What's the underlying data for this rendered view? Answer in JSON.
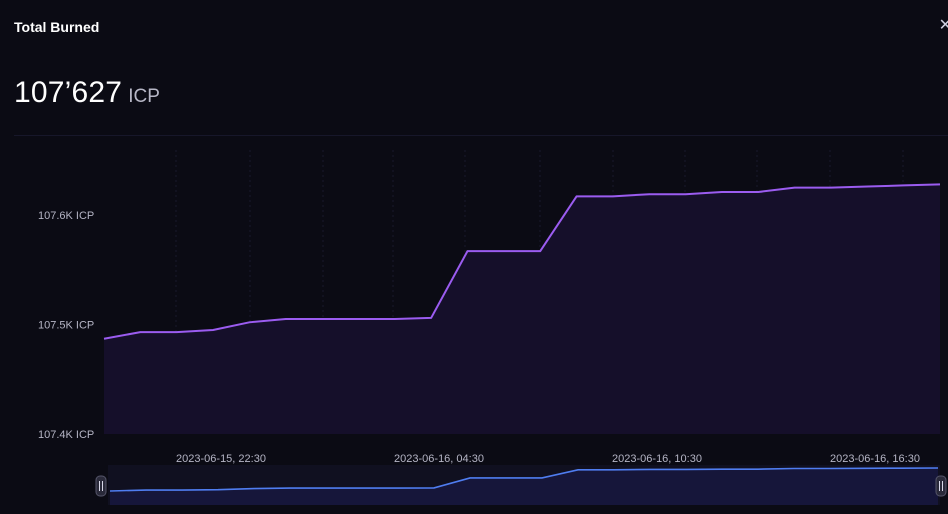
{
  "header": {
    "title": "Total Burned",
    "value": "107’627",
    "unit": "ICP",
    "close_icon": "close-icon"
  },
  "colors": {
    "background": "#0b0b14",
    "line": "#9b5cf0",
    "area": "#150f2a",
    "navigator_line": "#4f7df0",
    "navigator_area": "#16163a"
  },
  "chart_data": {
    "type": "area",
    "title": "",
    "xlabel": "",
    "ylabel": "",
    "ylim": [
      107400,
      107600
    ],
    "yticks": [
      107400,
      107500,
      107600
    ],
    "ytick_labels": [
      "107.4K ICP",
      "107.5K ICP",
      "107.6K ICP"
    ],
    "xtick_labels": [
      "2023-06-15, 22:30",
      "2023-06-16, 04:30",
      "2023-06-16, 10:30",
      "2023-06-16, 16:30"
    ],
    "grid": true,
    "series": [
      {
        "x": [
          "2023-06-15, 18:30",
          "2023-06-15, 19:30",
          "2023-06-15, 20:30",
          "2023-06-15, 21:30",
          "2023-06-15, 22:30",
          "2023-06-15, 23:30",
          "2023-06-16, 00:30",
          "2023-06-16, 01:30",
          "2023-06-16, 02:30",
          "2023-06-16, 03:30",
          "2023-06-16, 04:30",
          "2023-06-16, 05:30",
          "2023-06-16, 06:30",
          "2023-06-16, 07:30",
          "2023-06-16, 08:30",
          "2023-06-16, 09:30",
          "2023-06-16, 10:30",
          "2023-06-16, 11:30",
          "2023-06-16, 12:30",
          "2023-06-16, 13:30",
          "2023-06-16, 14:30",
          "2023-06-16, 15:30",
          "2023-06-16, 16:30",
          "2023-06-16, 17:30"
        ],
        "values": [
          107487,
          107493,
          107493,
          107495,
          107502,
          107505,
          107505,
          107505,
          107505,
          107506,
          107567,
          107567,
          107567,
          107617,
          107617,
          107619,
          107619,
          107621,
          107621,
          107625,
          107625,
          107626,
          107627,
          107628
        ]
      }
    ]
  }
}
